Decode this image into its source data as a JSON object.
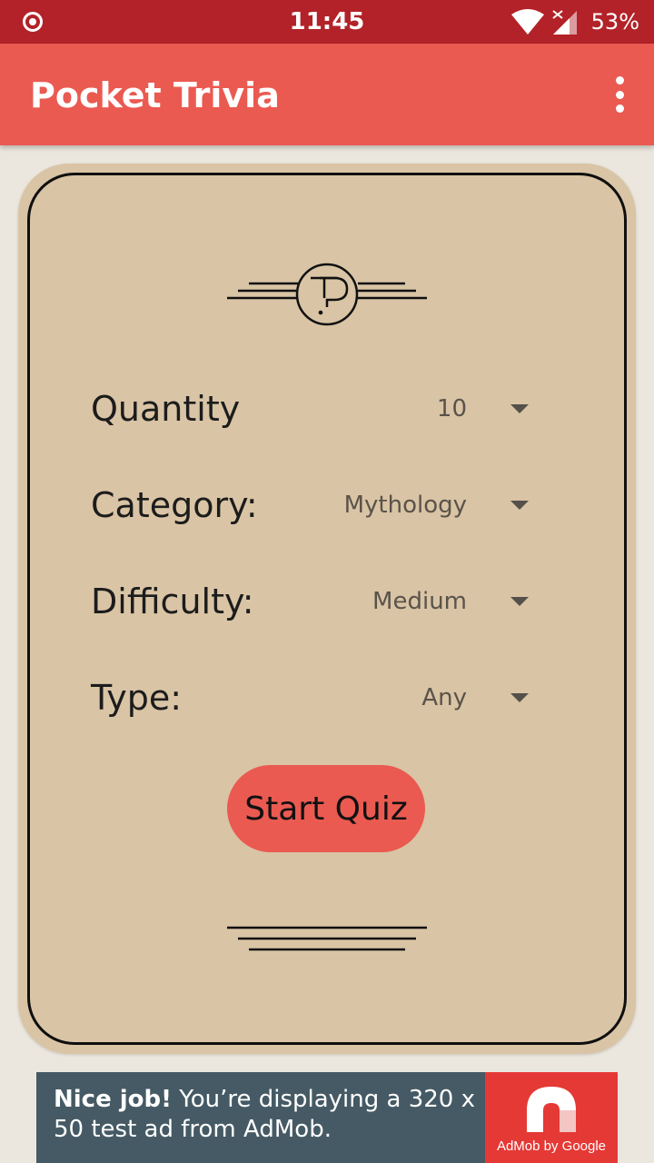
{
  "status_bar": {
    "time": "11:45",
    "battery": "53%",
    "icons": [
      "record-icon",
      "wifi-icon",
      "cell-signal-icon"
    ]
  },
  "app_bar": {
    "title": "Pocket Trivia",
    "menu_icon": "overflow-menu-icon"
  },
  "form": {
    "rows": [
      {
        "label": "Quantity",
        "value": "10"
      },
      {
        "label": "Category:",
        "value": "Mythology"
      },
      {
        "label": "Difficulty:",
        "value": "Medium"
      },
      {
        "label": "Type:",
        "value": "Any"
      }
    ],
    "start_label": "Start Quiz"
  },
  "ad": {
    "headline": "Nice job!",
    "body": " You’re displaying a 320 x 50 test ad from AdMob.",
    "brand": "AdMob by Google"
  },
  "colors": {
    "status_bar": "#b22228",
    "app_bar": "#ea5a51",
    "card": "#d9c4a5",
    "button": "#ea5a51",
    "ad_background": "#455a64",
    "ad_logo": "#e53935"
  }
}
